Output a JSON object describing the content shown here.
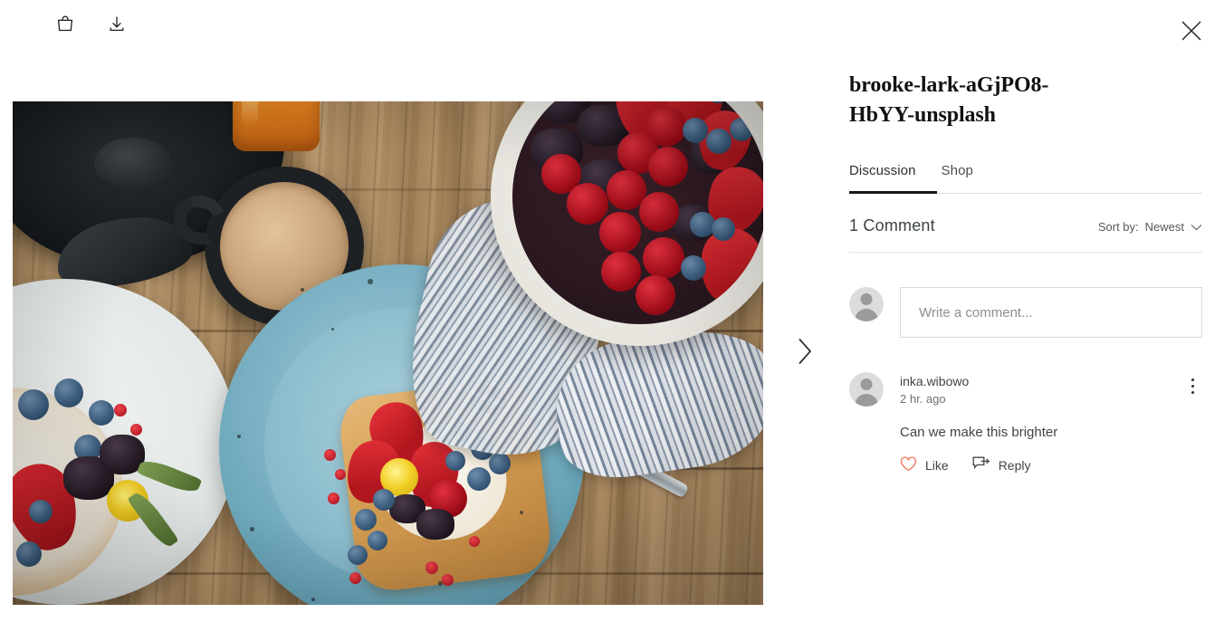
{
  "toolbar": {
    "cart_icon": "shopping-bag-icon",
    "download_icon": "download-icon",
    "close_icon": "close-icon"
  },
  "media": {
    "next_icon": "chevron-right-icon",
    "alt": "Flat lay of berry topped toast on a blue speckled plate with coffee and a bowl of cherries"
  },
  "panel": {
    "title": "brooke-lark-aGjPO8-HbYY-unsplash",
    "tabs": [
      {
        "label": "Discussion",
        "active": true
      },
      {
        "label": "Shop",
        "active": false
      }
    ],
    "comment_count": "1 Comment",
    "sort": {
      "label": "Sort by:",
      "value": "Newest",
      "chevron_icon": "chevron-down-icon"
    },
    "compose": {
      "placeholder": "Write a comment...",
      "avatar_icon": "user-avatar-icon"
    },
    "comments": [
      {
        "author": "inka.wibowo",
        "time": "2 hr. ago",
        "text": "Can we make this brighter",
        "avatar_icon": "user-avatar-icon",
        "menu_icon": "more-options-icon",
        "like_label": "Like",
        "like_icon": "heart-icon",
        "reply_label": "Reply",
        "reply_icon": "reply-icon"
      }
    ]
  },
  "colors": {
    "accent_like": "#f07a60",
    "text_primary": "#3f4447",
    "text_muted": "#6c7174",
    "underline_active": "#17191a",
    "border": "#d8d8d8"
  }
}
